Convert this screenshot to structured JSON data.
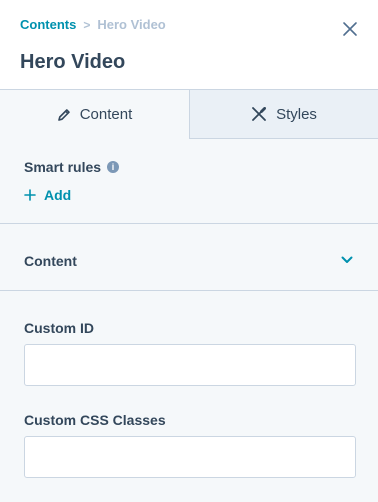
{
  "breadcrumb": {
    "parent": "Contents",
    "separator": ">",
    "current": "Hero Video"
  },
  "title": "Hero Video",
  "tabs": [
    {
      "label": "Content",
      "icon": "pencil-icon",
      "active": true
    },
    {
      "label": "Styles",
      "icon": "styles-icon",
      "active": false
    }
  ],
  "smart_rules": {
    "label": "Smart rules",
    "info_icon": "info-icon",
    "add_label": "Add"
  },
  "content_section": {
    "label": "Content",
    "icon": "chevron-down-icon"
  },
  "fields": [
    {
      "label": "Custom ID",
      "value": "",
      "placeholder": ""
    },
    {
      "label": "Custom CSS Classes",
      "value": "",
      "placeholder": ""
    }
  ],
  "colors": {
    "accent": "#0091ae",
    "text": "#33475b",
    "panel_bg": "#f5f8fa",
    "border": "#cbd6e2"
  }
}
